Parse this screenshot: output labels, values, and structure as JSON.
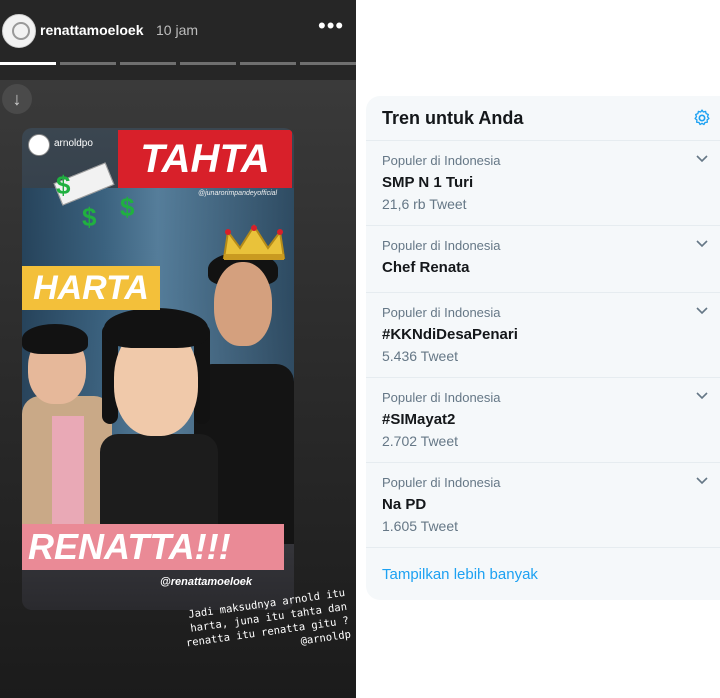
{
  "story": {
    "username": "renattamoeloek",
    "time": "10 jam",
    "more_icon": "more-horizontal-icon",
    "download_icon": "download-icon",
    "progress_segments": 6,
    "card": {
      "mini_username": "arnoldpo",
      "tahta_text": "TAHTA",
      "tag_top": "@junarorimpandeyofficial",
      "harta_text": "HARTA",
      "renatta_text": "RENATTA!!!",
      "tag_bottom": "@renattamoeloek"
    },
    "caption": "Jadi maksudnya arnold itu\nharta, juna itu tahta dan\nrenatta itu renatta gitu ?\n@arnoldp"
  },
  "trends": {
    "title": "Tren untuk Anda",
    "settings_icon": "gear-icon",
    "items": [
      {
        "context": "Populer di Indonesia",
        "name": "SMP N 1 Turi",
        "count": "21,6 rb Tweet"
      },
      {
        "context": "Populer di Indonesia",
        "name": "Chef Renata",
        "count": ""
      },
      {
        "context": "Populer di Indonesia",
        "name": "#KKNdiDesaPenari",
        "count": "5.436 Tweet"
      },
      {
        "context": "Populer di Indonesia",
        "name": "#SIMayat2",
        "count": "2.702 Tweet"
      },
      {
        "context": "Populer di Indonesia",
        "name": "Na PD",
        "count": "1.605 Tweet"
      }
    ],
    "show_more": "Tampilkan lebih banyak",
    "accent_color": "#1da1f2"
  }
}
